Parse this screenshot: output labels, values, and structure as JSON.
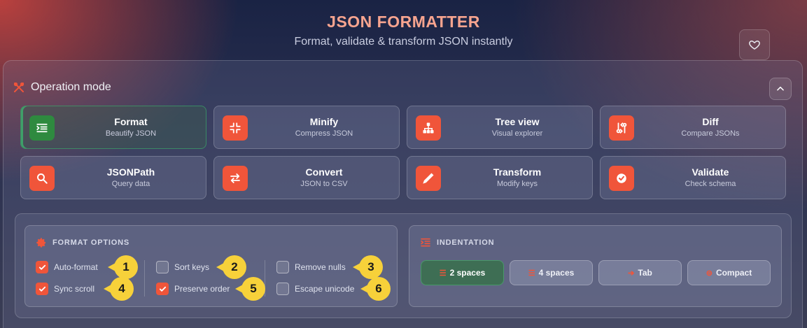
{
  "header": {
    "title": "JSON FORMATTER",
    "subtitle": "Format, validate & transform JSON instantly",
    "favorite_icon": "heart-icon"
  },
  "operation": {
    "label": "Operation mode",
    "icon": "tools-icon",
    "collapse_icon": "chevron-up-icon",
    "modes": [
      {
        "name": "Format",
        "desc": "Beautify JSON",
        "icon": "format-icon",
        "active": true
      },
      {
        "name": "Minify",
        "desc": "Compress JSON",
        "icon": "compress-icon",
        "active": false
      },
      {
        "name": "Tree view",
        "desc": "Visual explorer",
        "icon": "tree-icon",
        "active": false
      },
      {
        "name": "Diff",
        "desc": "Compare JSONs",
        "icon": "diff-icon",
        "active": false
      },
      {
        "name": "JSONPath",
        "desc": "Query data",
        "icon": "search-icon",
        "active": false
      },
      {
        "name": "Convert",
        "desc": "JSON to CSV",
        "icon": "swap-icon",
        "active": false
      },
      {
        "name": "Transform",
        "desc": "Modify keys",
        "icon": "pencil-icon",
        "active": false
      },
      {
        "name": "Validate",
        "desc": "Check schema",
        "icon": "check-icon",
        "active": false
      }
    ]
  },
  "format_options": {
    "title": "FORMAT OPTIONS",
    "icon": "gear-icon",
    "options": [
      {
        "label": "Auto-format",
        "checked": true,
        "badge": "1"
      },
      {
        "label": "Sort keys",
        "checked": false,
        "badge": "2"
      },
      {
        "label": "Remove nulls",
        "checked": false,
        "badge": "3"
      },
      {
        "label": "Sync scroll",
        "checked": true,
        "badge": "4"
      },
      {
        "label": "Preserve order",
        "checked": true,
        "badge": "5"
      },
      {
        "label": "Escape unicode",
        "checked": false,
        "badge": "6"
      }
    ]
  },
  "indentation": {
    "title": "INDENTATION",
    "icon": "indent-icon",
    "choices": [
      {
        "label": "2 spaces",
        "active": true
      },
      {
        "label": "4 spaces",
        "active": false
      },
      {
        "label": "Tab",
        "active": false
      },
      {
        "label": "Compact",
        "active": false
      }
    ]
  },
  "colors": {
    "accent": "#f0553a",
    "active_green": "#2e8a3f",
    "title": "#f7a48f",
    "badge": "#f7d13a"
  }
}
